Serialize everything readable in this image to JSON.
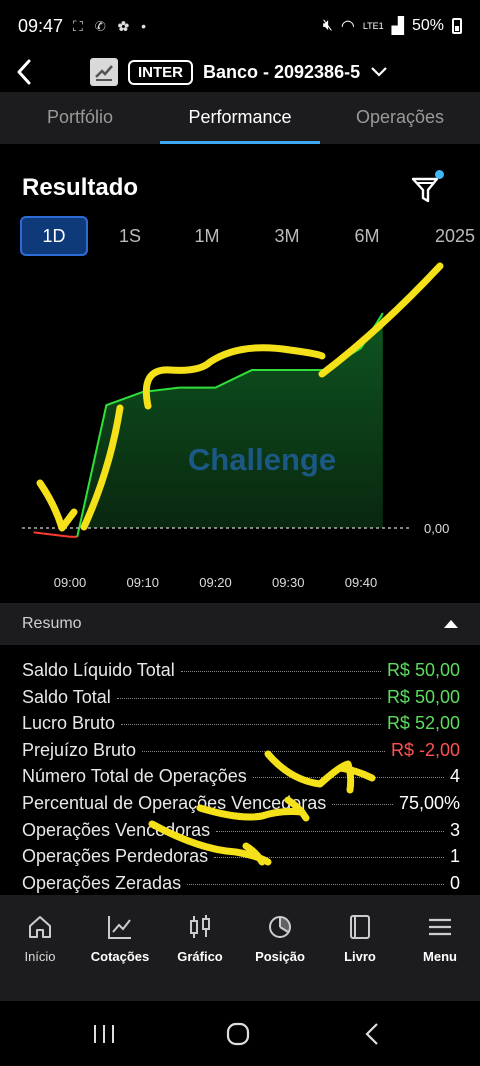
{
  "status_bar": {
    "time": "09:47",
    "battery": "50%",
    "network": "LTE1"
  },
  "header": {
    "badge": "INTER",
    "account_name": "Banco - 2092386-5"
  },
  "tabs": [
    "Portfólio",
    "Performance",
    "Operações"
  ],
  "active_tab": "Performance",
  "result": {
    "title": "Resultado"
  },
  "periods": [
    "1D",
    "1S",
    "1M",
    "3M",
    "6M",
    "2025"
  ],
  "active_period": "1D",
  "chart_data": {
    "type": "area",
    "x": [
      "08:55",
      "09:00",
      "09:01",
      "09:05",
      "09:10",
      "09:15",
      "09:20",
      "09:25",
      "09:30",
      "09:35",
      "09:40",
      "09:43"
    ],
    "values": [
      -1,
      -2,
      -2,
      28,
      31,
      32,
      32,
      36,
      36,
      36,
      41,
      49
    ],
    "x_tick_labels": [
      "09:00",
      "09:10",
      "09:20",
      "09:30",
      "09:40"
    ],
    "y_reference_label": "0,00",
    "watermark": "Challenge",
    "colors": {
      "line_positive": "#2fe03a",
      "line_negative": "#ff3b30",
      "fill": "#0e4a1e"
    },
    "grid": false
  },
  "summary": {
    "title": "Resumo",
    "rows": [
      {
        "label": "Saldo Líquido Total",
        "value": "R$ 50,00",
        "tone": "green"
      },
      {
        "label": "Saldo Total",
        "value": "R$ 50,00",
        "tone": "green"
      },
      {
        "label": "Lucro Bruto",
        "value": "R$ 52,00",
        "tone": "green"
      },
      {
        "label": "Prejuízo Bruto",
        "value": "R$ -2,00",
        "tone": "red"
      },
      {
        "label": "Número Total de Operações",
        "value": "4",
        "tone": "white"
      },
      {
        "label": "Percentual de Operações Vencedoras",
        "value": "75,00%",
        "tone": "white"
      },
      {
        "label": "Operações Vencedoras",
        "value": "3",
        "tone": "white"
      },
      {
        "label": "Operações Perdedoras",
        "value": "1",
        "tone": "white"
      },
      {
        "label": "Operações Zeradas",
        "value": "0",
        "tone": "white"
      }
    ]
  },
  "bottom_nav": [
    {
      "label": "Início",
      "icon": "home-icon"
    },
    {
      "label": "Cotações",
      "icon": "line-chart-icon"
    },
    {
      "label": "Gráfico",
      "icon": "candlestick-icon"
    },
    {
      "label": "Posição",
      "icon": "pie-chart-icon"
    },
    {
      "label": "Livro",
      "icon": "book-icon"
    },
    {
      "label": "Menu",
      "icon": "menu-icon"
    }
  ],
  "colors": {
    "accent": "#3fa9f5",
    "annotation": "#f5e11a"
  }
}
